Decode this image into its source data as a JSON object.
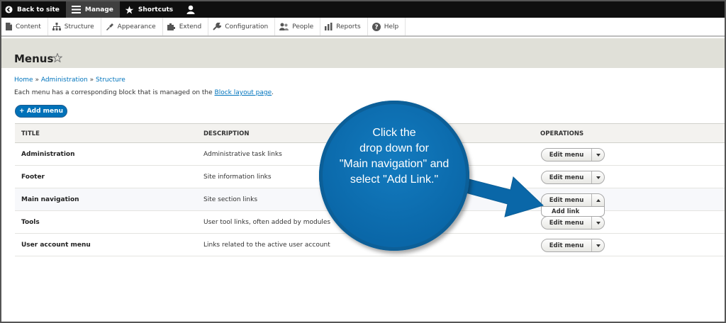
{
  "toolbar": {
    "back": "Back to site",
    "manage": "Manage",
    "shortcuts": "Shortcuts"
  },
  "tray": [
    "Content",
    "Structure",
    "Appearance",
    "Extend",
    "Configuration",
    "People",
    "Reports",
    "Help"
  ],
  "page": {
    "title": "Menus",
    "breadcrumb": [
      "Home",
      "Administration",
      "Structure"
    ],
    "breadcrumb_sep": "»",
    "help_prefix": "Each menu has a corresponding block that is managed on the ",
    "help_link": "Block layout page",
    "help_suffix": ".",
    "add_menu": "+ Add menu"
  },
  "table": {
    "headers": [
      "TITLE",
      "DESCRIPTION",
      "OPERATIONS"
    ],
    "rows": [
      {
        "title": "Administration",
        "description": "Administrative task links",
        "op": "Edit menu"
      },
      {
        "title": "Footer",
        "description": "Site information links",
        "op": "Edit menu"
      },
      {
        "title": "Main navigation",
        "description": "Site section links",
        "op": "Edit menu"
      },
      {
        "title": "Tools",
        "description": "User tool links, often added by modules",
        "op": "Edit menu"
      },
      {
        "title": "User account menu",
        "description": "Links related to the active user account",
        "op": "Edit menu"
      }
    ],
    "dropdown_item": "Add link"
  },
  "callout": {
    "text": "Click the\ndrop down for\n\"Main navigation\" and\nselect \"Add Link.\""
  },
  "colors": {
    "link": "#0074bd",
    "primary_button": "#0071b8",
    "callout": "#0a67a8",
    "toolbar": "#0f0f0f"
  }
}
